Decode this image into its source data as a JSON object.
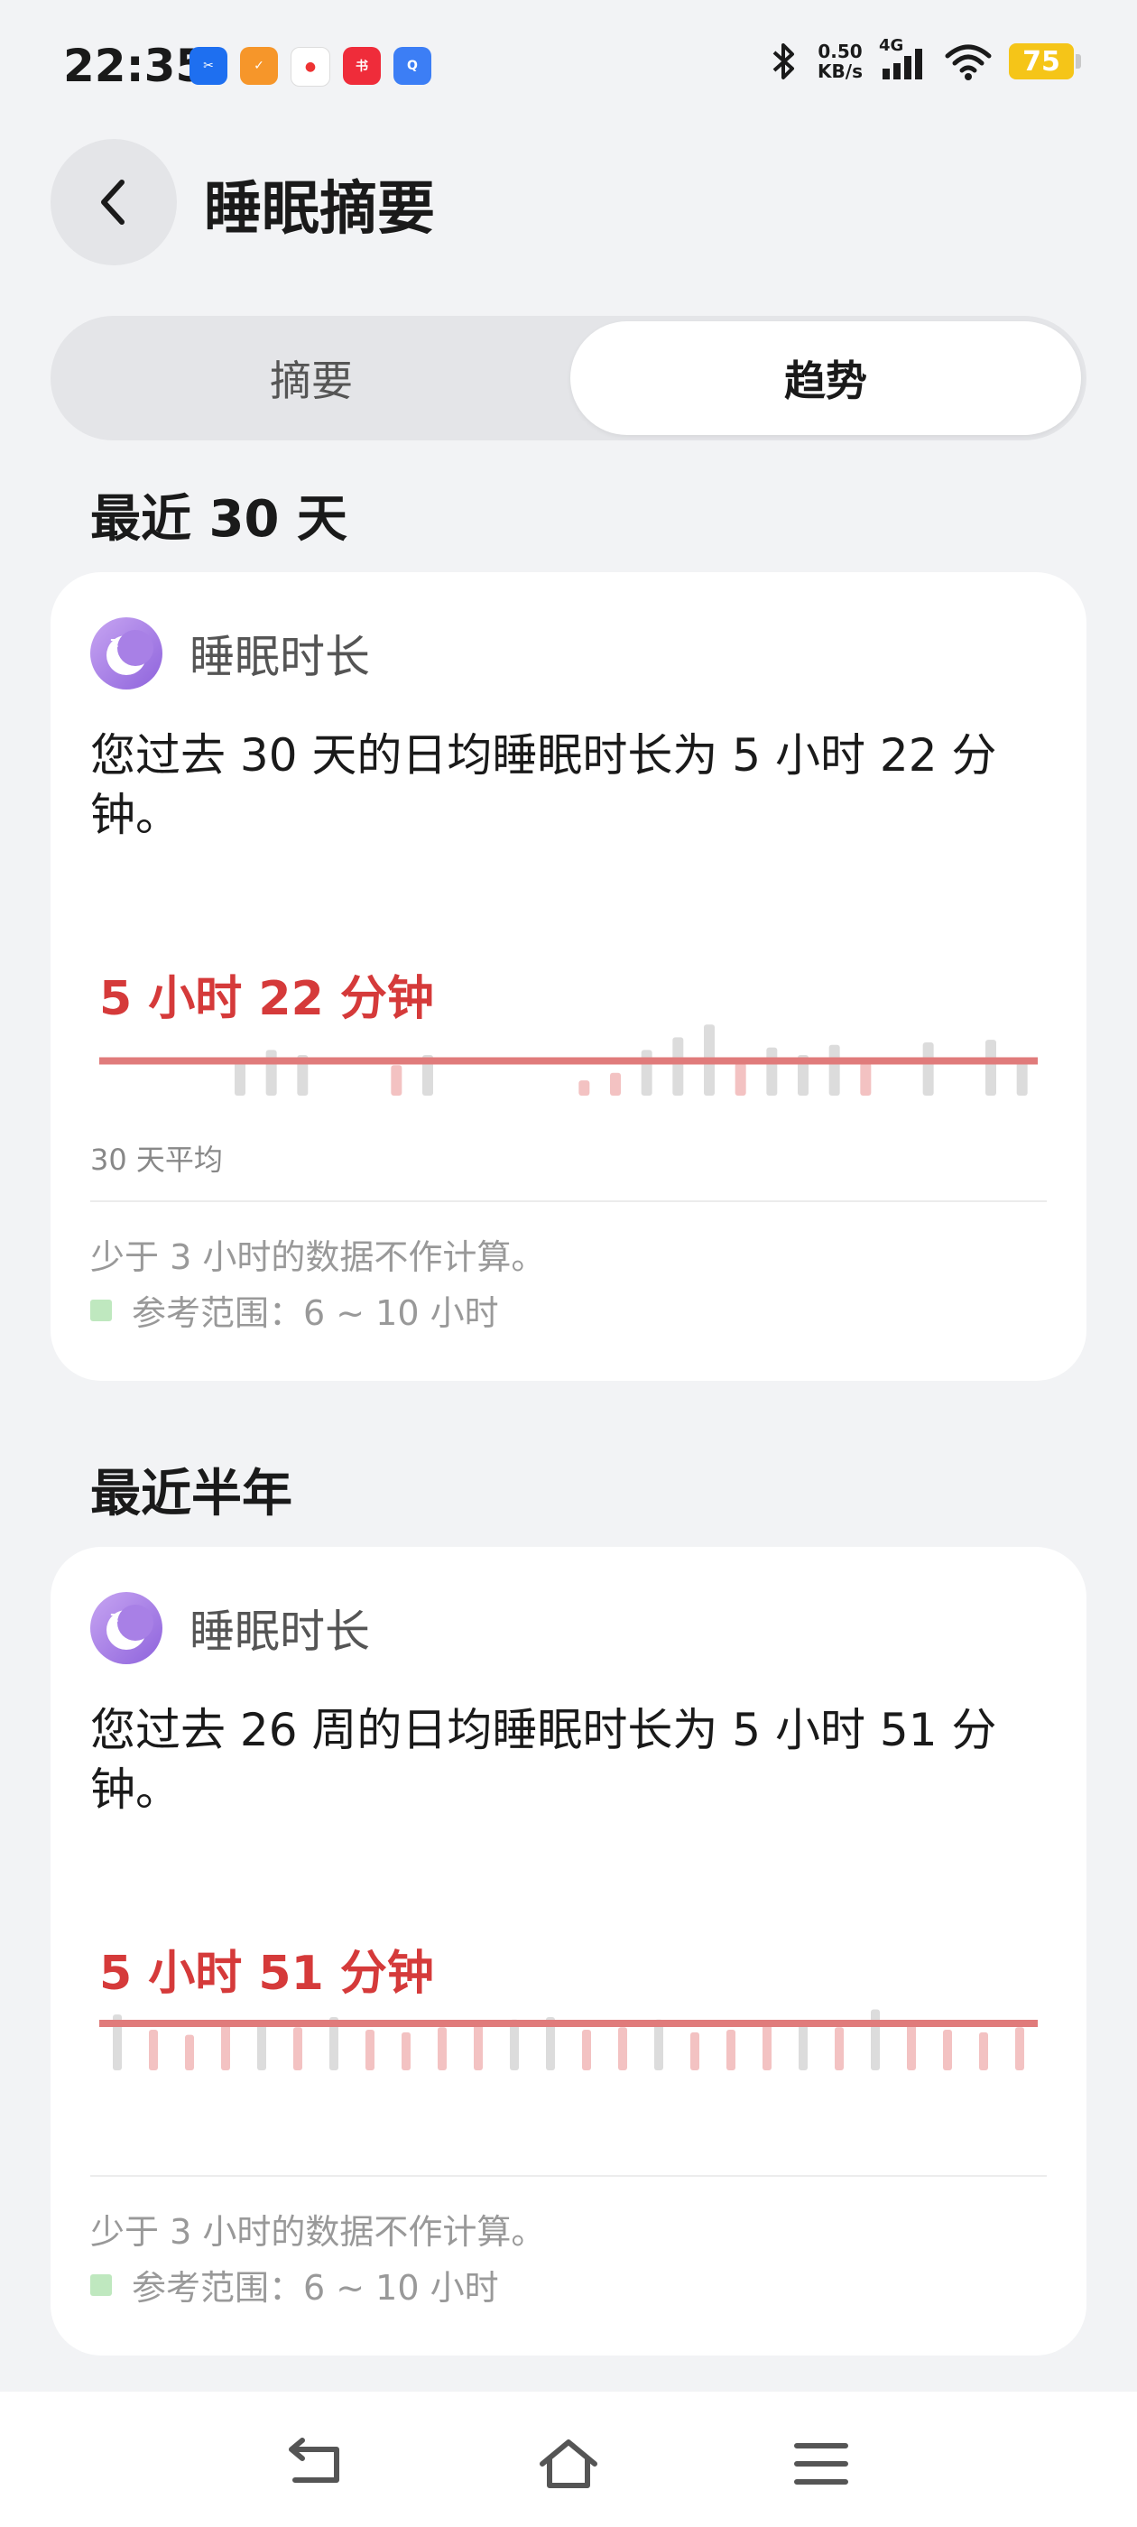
{
  "status_bar": {
    "time": "22:35",
    "net_speed_value": "0.50",
    "net_speed_unit": "KB/s",
    "network_type": "4G",
    "battery": "75",
    "notification_icons": [
      "app-blue-icon",
      "app-orange-icon",
      "maps-icon",
      "xiaohongshu-icon",
      "browser-icon"
    ]
  },
  "header": {
    "title": "睡眠摘要"
  },
  "tabs": [
    {
      "label": "摘要",
      "selected": false
    },
    {
      "label": "趋势",
      "selected": true
    }
  ],
  "sections": [
    {
      "title": "最近 30 天",
      "card": {
        "label": "睡眠时长",
        "description": "您过去 30 天的日均睡眠时长为 5 小时 22 分钟。",
        "avg_text": "5 小时 22 分钟",
        "avg_caption": "30 天平均",
        "note": "少于 3 小时的数据不作计算。",
        "reference": "参考范围：6 ~ 10 小时"
      }
    },
    {
      "title": "最近半年",
      "card": {
        "label": "睡眠时长",
        "description": "您过去 26 周的日均睡眠时长为 5 小时 51 分钟。",
        "avg_text": "5 小时 51 分钟",
        "note": "少于 3 小时的数据不作计算。",
        "reference": "参考范围：6 ~ 10 小时"
      }
    }
  ],
  "chart_data": [
    {
      "type": "bar",
      "title": "睡眠时长",
      "average_hours": 5.37,
      "average_label": "5 小时 22 分钟",
      "unit": "hours",
      "values": [
        0,
        0,
        0,
        0,
        5.5,
        5.8,
        5.6,
        0,
        0,
        5.2,
        5.6,
        0,
        0,
        0,
        0,
        4.6,
        4.9,
        5.8,
        6.3,
        6.8,
        5.3,
        5.9,
        5.6,
        6.0,
        5.3,
        0,
        6.1,
        0,
        6.2,
        5.4
      ],
      "reference_range": [
        6,
        10
      ]
    },
    {
      "type": "bar",
      "title": "睡眠时长",
      "average_hours": 5.85,
      "average_label": "5 小时 51 分钟",
      "unit": "hours",
      "values": [
        6.2,
        5.6,
        5.4,
        5.8,
        5.9,
        5.7,
        6.1,
        5.6,
        5.5,
        5.7,
        5.8,
        6.0,
        6.1,
        5.6,
        5.7,
        6.0,
        5.5,
        5.6,
        5.8,
        5.9,
        5.7,
        6.4,
        5.8,
        5.6,
        5.5,
        5.7
      ],
      "reference_range": [
        6,
        10
      ]
    }
  ]
}
